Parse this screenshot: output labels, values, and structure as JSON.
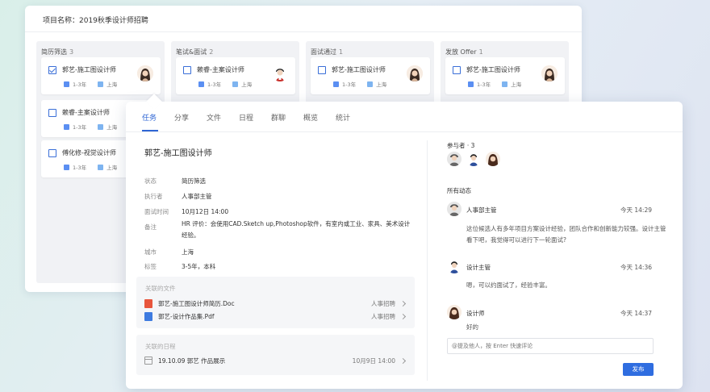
{
  "project": {
    "label": "项目名称：2019秋季设计师招聘"
  },
  "columns": [
    {
      "title": "简历筛选",
      "count": "3",
      "cards": [
        {
          "name": "郭艺-施工图设计师",
          "exp": "1-3年",
          "city": "上海",
          "checked": true,
          "avatar": "woman"
        },
        {
          "name": "赖睿-主案设计师",
          "exp": "1-3年",
          "city": "上海"
        },
        {
          "name": "傅化修-视觉设计师",
          "exp": "1-3年",
          "city": "上海"
        }
      ]
    },
    {
      "title": "笔试&面试",
      "count": "2",
      "cards": [
        {
          "name": "赖睿-主案设计师",
          "exp": "1-3年",
          "city": "上海",
          "avatar": "man"
        }
      ]
    },
    {
      "title": "面试通过",
      "count": "1",
      "cards": [
        {
          "name": "郭艺-施工图设计师",
          "exp": "1-3年",
          "city": "上海",
          "avatar": "woman"
        }
      ]
    },
    {
      "title": "发放 Offer",
      "count": "1",
      "cards": [
        {
          "name": "郭艺-施工图设计师",
          "exp": "1-3年",
          "city": "上海",
          "avatar": "woman"
        }
      ]
    }
  ],
  "tabs": [
    "任务",
    "分享",
    "文件",
    "日程",
    "群聊",
    "概览",
    "统计"
  ],
  "task": {
    "title": "郭艺-施工图设计师",
    "fields": [
      {
        "label": "状态",
        "value": "简历筛选"
      },
      {
        "label": "执行者",
        "value": "人事部主管"
      },
      {
        "label": "面试时间",
        "value": "10月12日 14:00"
      },
      {
        "label": "备注",
        "value": "HR 评价：会使用CAD.Sketch up,Photoshop软件，有室内或工业、家具、美术设计经验。"
      },
      {
        "label": "城市",
        "value": "上海"
      },
      {
        "label": "标签",
        "value": "3-5年，本科"
      }
    ],
    "files_title": "关联的文件",
    "files": [
      {
        "name": "郭艺-施工图设计师简历.Doc",
        "category": "人事招聘",
        "icon": "doc-icon"
      },
      {
        "name": "郭艺-设计作品集.Pdf",
        "category": "人事招聘",
        "icon": "pdf-icon"
      }
    ],
    "schedule_title": "关联的日程",
    "schedule": {
      "name": "19.10.09 郭艺 作品展示",
      "time": "10月9日 14:00"
    }
  },
  "participants": {
    "title": "参与者 · 3"
  },
  "activity": {
    "title": "所有动态",
    "items": [
      {
        "name": "人事部主管",
        "time": "今天 14:29",
        "text": "这位候选人有多年项目方案设计经验，团队合作和创新能力较强。设计主管看下吧，我觉得可以进行下一轮面试?"
      },
      {
        "name": "设计主管",
        "time": "今天 14:36",
        "text": "嗯，可以约面试了，经验丰富。"
      },
      {
        "name": "设计师",
        "time": "今天 14:37",
        "text": "好的"
      }
    ],
    "comment_placeholder": "@提及他人，按 Enter 快速评论",
    "publish_label": "发布"
  },
  "colors": {
    "accent": "#2f66d4",
    "doc": "#e8553c",
    "pdf": "#3e7be0"
  }
}
